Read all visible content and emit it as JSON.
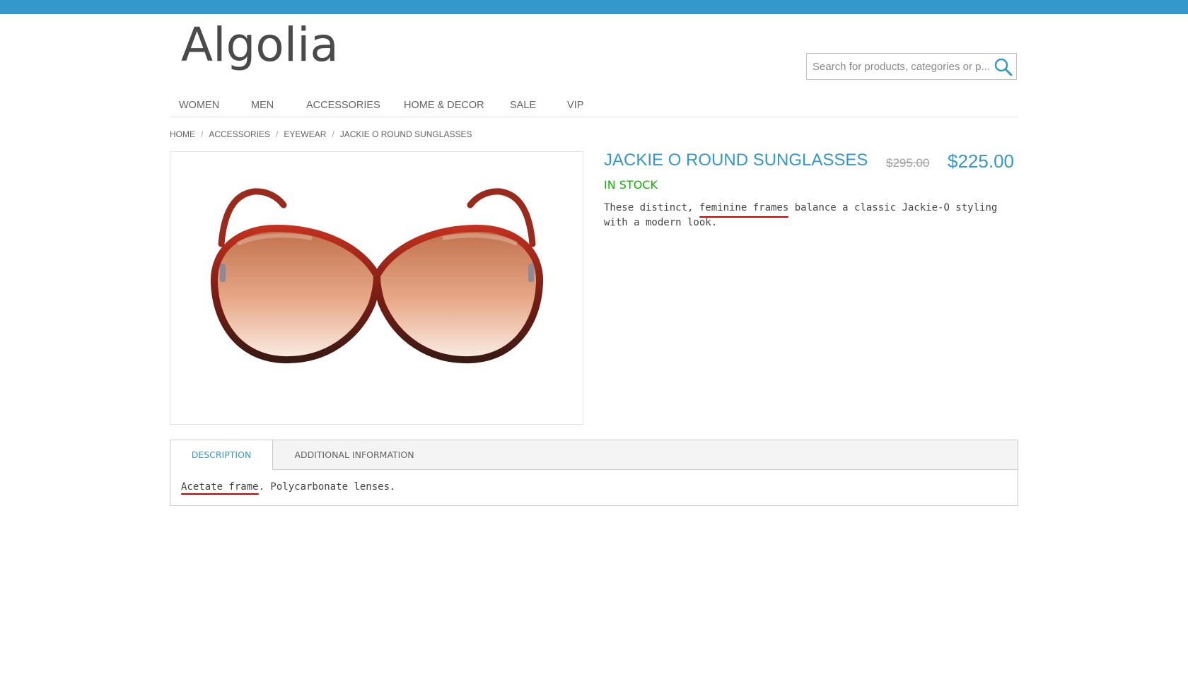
{
  "header": {
    "logo_text": "Algolia",
    "search_placeholder": "Search for products, categories or p..."
  },
  "nav": {
    "items": [
      "WOMEN",
      "MEN",
      "ACCESSORIES",
      "HOME & DECOR",
      "SALE",
      "VIP"
    ]
  },
  "breadcrumb": {
    "home": "HOME",
    "accessories": "ACCESSORIES",
    "eyewear": "EYEWEAR",
    "current": "JACKIE O ROUND SUNGLASSES",
    "separator": "/"
  },
  "product": {
    "title": "JACKIE O ROUND SUNGLASSES",
    "old_price": "$295.00",
    "price": "$225.00",
    "stock": "IN STOCK",
    "desc_before": "These distinct, ",
    "desc_highlight": "feminine frames",
    "desc_after": " balance a classic Jackie-O styling with a modern look."
  },
  "tabs": {
    "description_label": "DESCRIPTION",
    "additional_label": "ADDITIONAL INFORMATION",
    "content_highlight": "Acetate frame",
    "content_rest": ". Polycarbonate lenses."
  },
  "colors": {
    "accent": "#3399cc",
    "in_stock": "#11b400",
    "annotation_underline": "#cc0000"
  }
}
